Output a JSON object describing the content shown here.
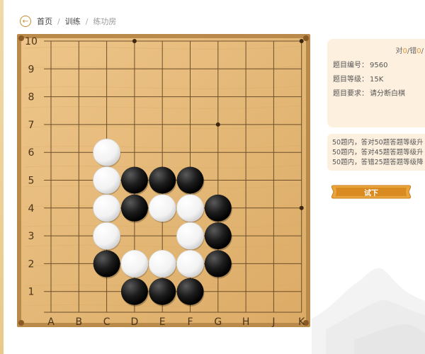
{
  "breadcrumb": {
    "back_icon": "back-arrow-icon",
    "home": "首页",
    "training": "训练",
    "current": "练功房"
  },
  "board": {
    "size": 10,
    "columns": [
      "A",
      "B",
      "C",
      "D",
      "E",
      "F",
      "G",
      "H",
      "J",
      "K"
    ],
    "rows": [
      "1",
      "2",
      "3",
      "4",
      "5",
      "6",
      "7",
      "8",
      "9",
      "10"
    ],
    "star_points": [
      "D10",
      "K10",
      "G7",
      "K4"
    ],
    "black_stones": [
      "D5",
      "E5",
      "F5",
      "D4",
      "G4",
      "G3",
      "C2",
      "G2",
      "D1",
      "E1",
      "F1"
    ],
    "white_stones": [
      "C6",
      "C5",
      "C4",
      "E4",
      "F4",
      "C3",
      "F3",
      "D2",
      "E2",
      "F2"
    ],
    "colors": {
      "wood": "#e4b877",
      "frame": "#b98a4a",
      "line": "#6e4f2a"
    }
  },
  "info": {
    "score_prefix": "对",
    "correct": "0",
    "score_mid": "/错",
    "wrong": "0",
    "score_suffix": "/",
    "problem_no_label": "题目编号：",
    "problem_no": "9560",
    "level_label": "题目等级：",
    "level": "15K",
    "requirement_label": "题目要求：",
    "requirement": "请分断白棋"
  },
  "rules": [
    "50题内，答对50题答题等级升",
    "50题内，答对45题答题等级升",
    "50题内，答错25题答题等级降"
  ],
  "try_button": {
    "label": "试下"
  },
  "accent_color": "#e49a3e"
}
